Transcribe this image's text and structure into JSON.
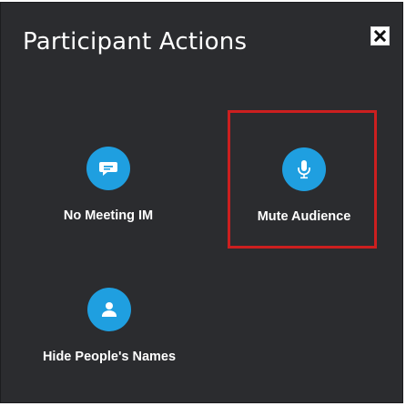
{
  "panel": {
    "title": "Participant Actions",
    "close_icon": "close-icon",
    "background_color": "#2b2c2f"
  },
  "actions": [
    {
      "label": "No Meeting IM",
      "icon": "chat-bubble-icon",
      "color": "#1f9fe0"
    },
    {
      "label": "Mute Audience",
      "icon": "microphone-icon",
      "color": "#1f9fe0",
      "highlighted": true
    },
    {
      "label": "Hide People's Names",
      "icon": "person-icon",
      "color": "#1f9fe0"
    }
  ],
  "highlight_color": "#cc1f1f"
}
